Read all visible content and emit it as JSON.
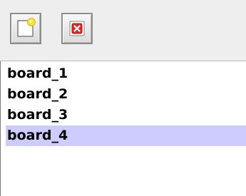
{
  "toolbar": {
    "new_icon": "new-board-icon",
    "delete_icon": "delete-board-icon"
  },
  "colors": {
    "selection": "#ccccff",
    "toolbar_bg": "#eeeeee",
    "delete_red": "#d42b2b",
    "new_highlight": "#f7e233"
  },
  "boards": {
    "selected_index": 3,
    "items": [
      {
        "label": "board_1"
      },
      {
        "label": "board_2"
      },
      {
        "label": "board_3"
      },
      {
        "label": "board_4"
      }
    ]
  }
}
